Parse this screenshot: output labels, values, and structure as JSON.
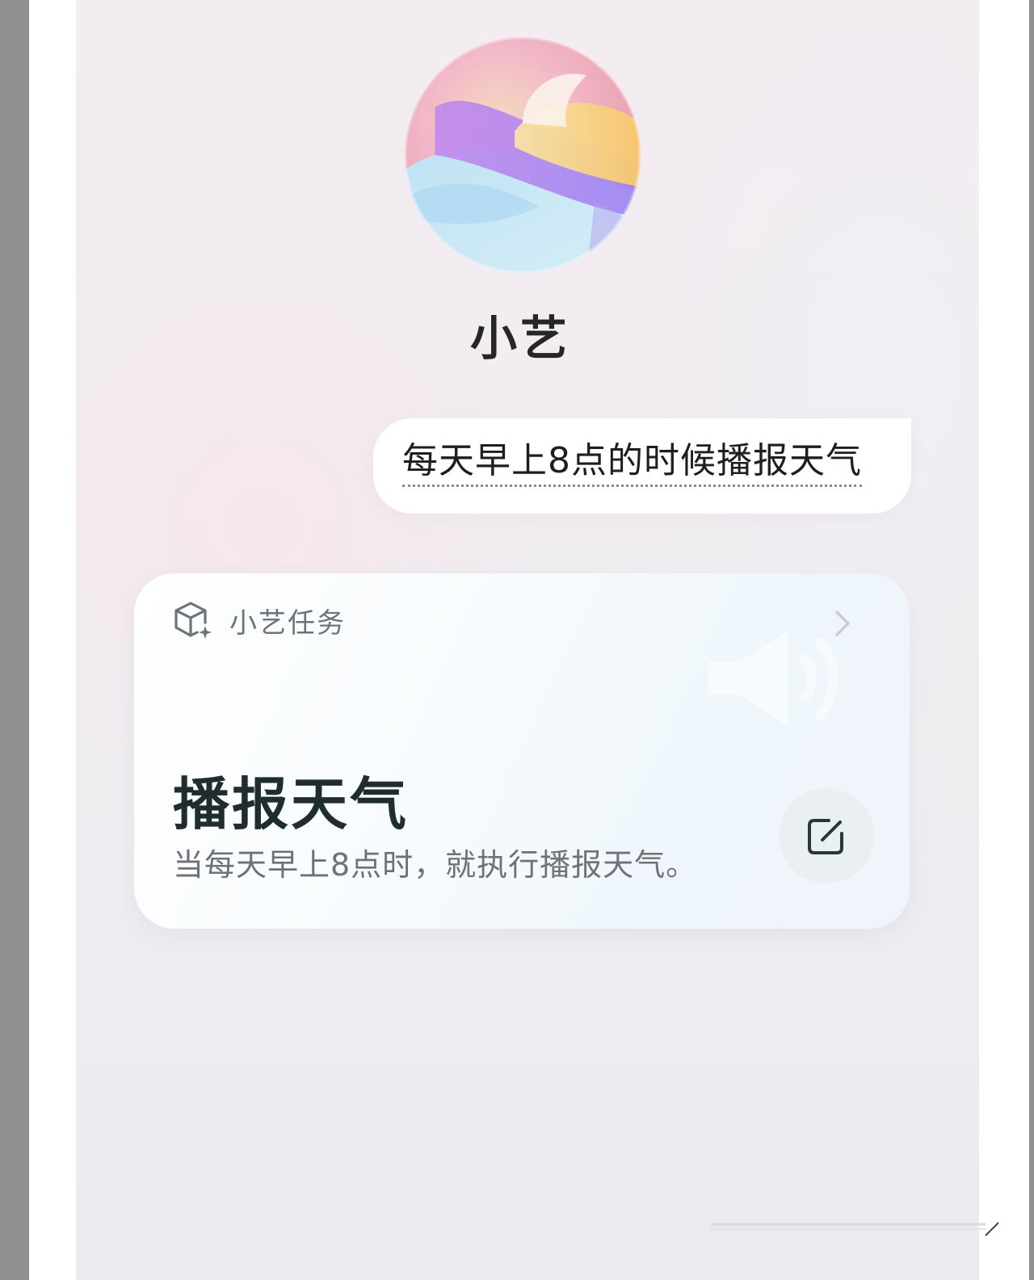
{
  "assistant": {
    "name": "小艺"
  },
  "user_message": {
    "text": "每天早上8点的时候播报天气"
  },
  "task_card": {
    "header_label": "小艺任务",
    "title": "播报天气",
    "description": "当每天早上8点时，就执行播报天气。"
  },
  "icons": {
    "header": "cube-sparkle-icon",
    "chevron": "chevron-right-icon",
    "watermark": "speaker-icon",
    "edit": "edit-icon"
  },
  "colors": {
    "title_text": "#1f2d2f",
    "muted_text": "#6e7276",
    "bubble_bg": "#ffffff",
    "edit_button_bg": "#eaeff2"
  }
}
